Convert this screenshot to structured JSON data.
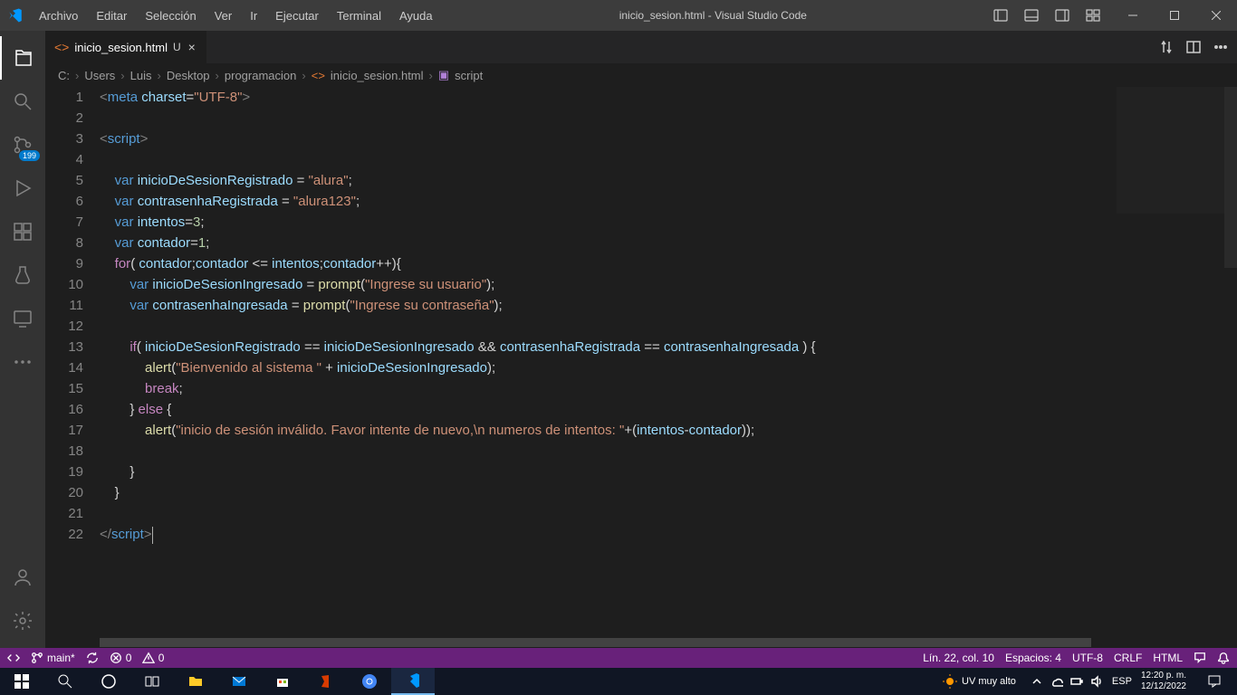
{
  "menubar": [
    "Archivo",
    "Editar",
    "Selección",
    "Ver",
    "Ir",
    "Ejecutar",
    "Terminal",
    "Ayuda"
  ],
  "window_title": "inicio_sesion.html - Visual Studio Code",
  "tab": {
    "name": "inicio_sesion.html",
    "modified": "U"
  },
  "breadcrumbs": [
    "C:",
    "Users",
    "Luis",
    "Desktop",
    "programacion",
    "inicio_sesion.html",
    "script"
  ],
  "scm_badge": "199",
  "status": {
    "branch": "main*",
    "errors": "0",
    "warnings": "0",
    "cursor": "Lín. 22, col. 10",
    "spaces": "Espacios: 4",
    "encoding": "UTF-8",
    "eol": "CRLF",
    "lang": "HTML"
  },
  "taskbar": {
    "weather_label": "UV muy alto",
    "lang": "ESP",
    "time": "12:20 p. m.",
    "date": "12/12/2022"
  },
  "code_lines": [
    {
      "n": 1,
      "html": "<span class='tag-b'>&lt;</span><span class='tag-n'>meta</span> <span class='attr'>charset</span><span class='op'>=</span><span class='str'>\"UTF-8\"</span><span class='tag-b'>&gt;</span>"
    },
    {
      "n": 2,
      "html": ""
    },
    {
      "n": 3,
      "html": "<span class='tag-b'>&lt;</span><span class='tag-n'>script</span><span class='tag-b'>&gt;</span>"
    },
    {
      "n": 4,
      "html": ""
    },
    {
      "n": 5,
      "html": "    <span class='kw'>var</span> <span class='var'>inicioDeSesionRegistrado</span> <span class='op'>=</span> <span class='str'>\"alura\"</span><span class='op'>;</span>"
    },
    {
      "n": 6,
      "html": "    <span class='kw'>var</span> <span class='var'>contrasenhaRegistrada</span> <span class='op'>=</span> <span class='str'>\"alura123\"</span><span class='op'>;</span>"
    },
    {
      "n": 7,
      "html": "    <span class='kw'>var</span> <span class='var'>intentos</span><span class='op'>=</span><span class='num'>3</span><span class='op'>;</span>"
    },
    {
      "n": 8,
      "html": "    <span class='kw'>var</span> <span class='var'>contador</span><span class='op'>=</span><span class='num'>1</span><span class='op'>;</span>"
    },
    {
      "n": 9,
      "html": "    <span class='kw2'>for</span><span class='op'>(</span> <span class='var'>contador</span><span class='op'>;</span><span class='var'>contador</span> <span class='op'>&lt;=</span> <span class='var'>intentos</span><span class='op'>;</span><span class='var'>contador</span><span class='op'>++){</span>"
    },
    {
      "n": 10,
      "html": "        <span class='kw'>var</span> <span class='var'>inicioDeSesionIngresado</span> <span class='op'>=</span> <span class='fn'>prompt</span><span class='op'>(</span><span class='str'>\"Ingrese su usuario\"</span><span class='op'>);</span>"
    },
    {
      "n": 11,
      "html": "        <span class='kw'>var</span> <span class='var'>contrasenhaIngresada</span> <span class='op'>=</span> <span class='fn'>prompt</span><span class='op'>(</span><span class='str'>\"Ingrese su contraseña\"</span><span class='op'>);</span>"
    },
    {
      "n": 12,
      "html": ""
    },
    {
      "n": 13,
      "html": "        <span class='kw2'>if</span><span class='op'>(</span> <span class='var'>inicioDeSesionRegistrado</span> <span class='op'>==</span> <span class='var'>inicioDeSesionIngresado</span> <span class='op'>&amp;&amp;</span> <span class='var'>contrasenhaRegistrada</span> <span class='op'>==</span> <span class='var'>contrasenhaIngresada</span> <span class='op'>) {</span>"
    },
    {
      "n": 14,
      "html": "            <span class='fn'>alert</span><span class='op'>(</span><span class='str'>\"Bienvenido al sistema \"</span> <span class='op'>+</span> <span class='var'>inicioDeSesionIngresado</span><span class='op'>);</span>"
    },
    {
      "n": 15,
      "html": "            <span class='kw2'>break</span><span class='op'>;</span>"
    },
    {
      "n": 16,
      "html": "        <span class='op'>}</span> <span class='kw2'>else</span> <span class='op'>{</span>"
    },
    {
      "n": 17,
      "html": "            <span class='fn'>alert</span><span class='op'>(</span><span class='str'>\"inicio de sesión inválido. Favor intente de nuevo,\\n numeros de intentos: \"</span><span class='op'>+(</span><span class='var'>intentos</span><span class='op'>-</span><span class='var'>contador</span><span class='op'>));</span>"
    },
    {
      "n": 18,
      "html": ""
    },
    {
      "n": 19,
      "html": "        <span class='op'>}</span>"
    },
    {
      "n": 20,
      "html": "    <span class='op'>}</span>"
    },
    {
      "n": 21,
      "html": ""
    },
    {
      "n": 22,
      "html": "<span class='tag-b'>&lt;/</span><span class='tag-n'>script</span><span class='tag-b'>&gt;</span><span class='cursor'></span>"
    }
  ]
}
